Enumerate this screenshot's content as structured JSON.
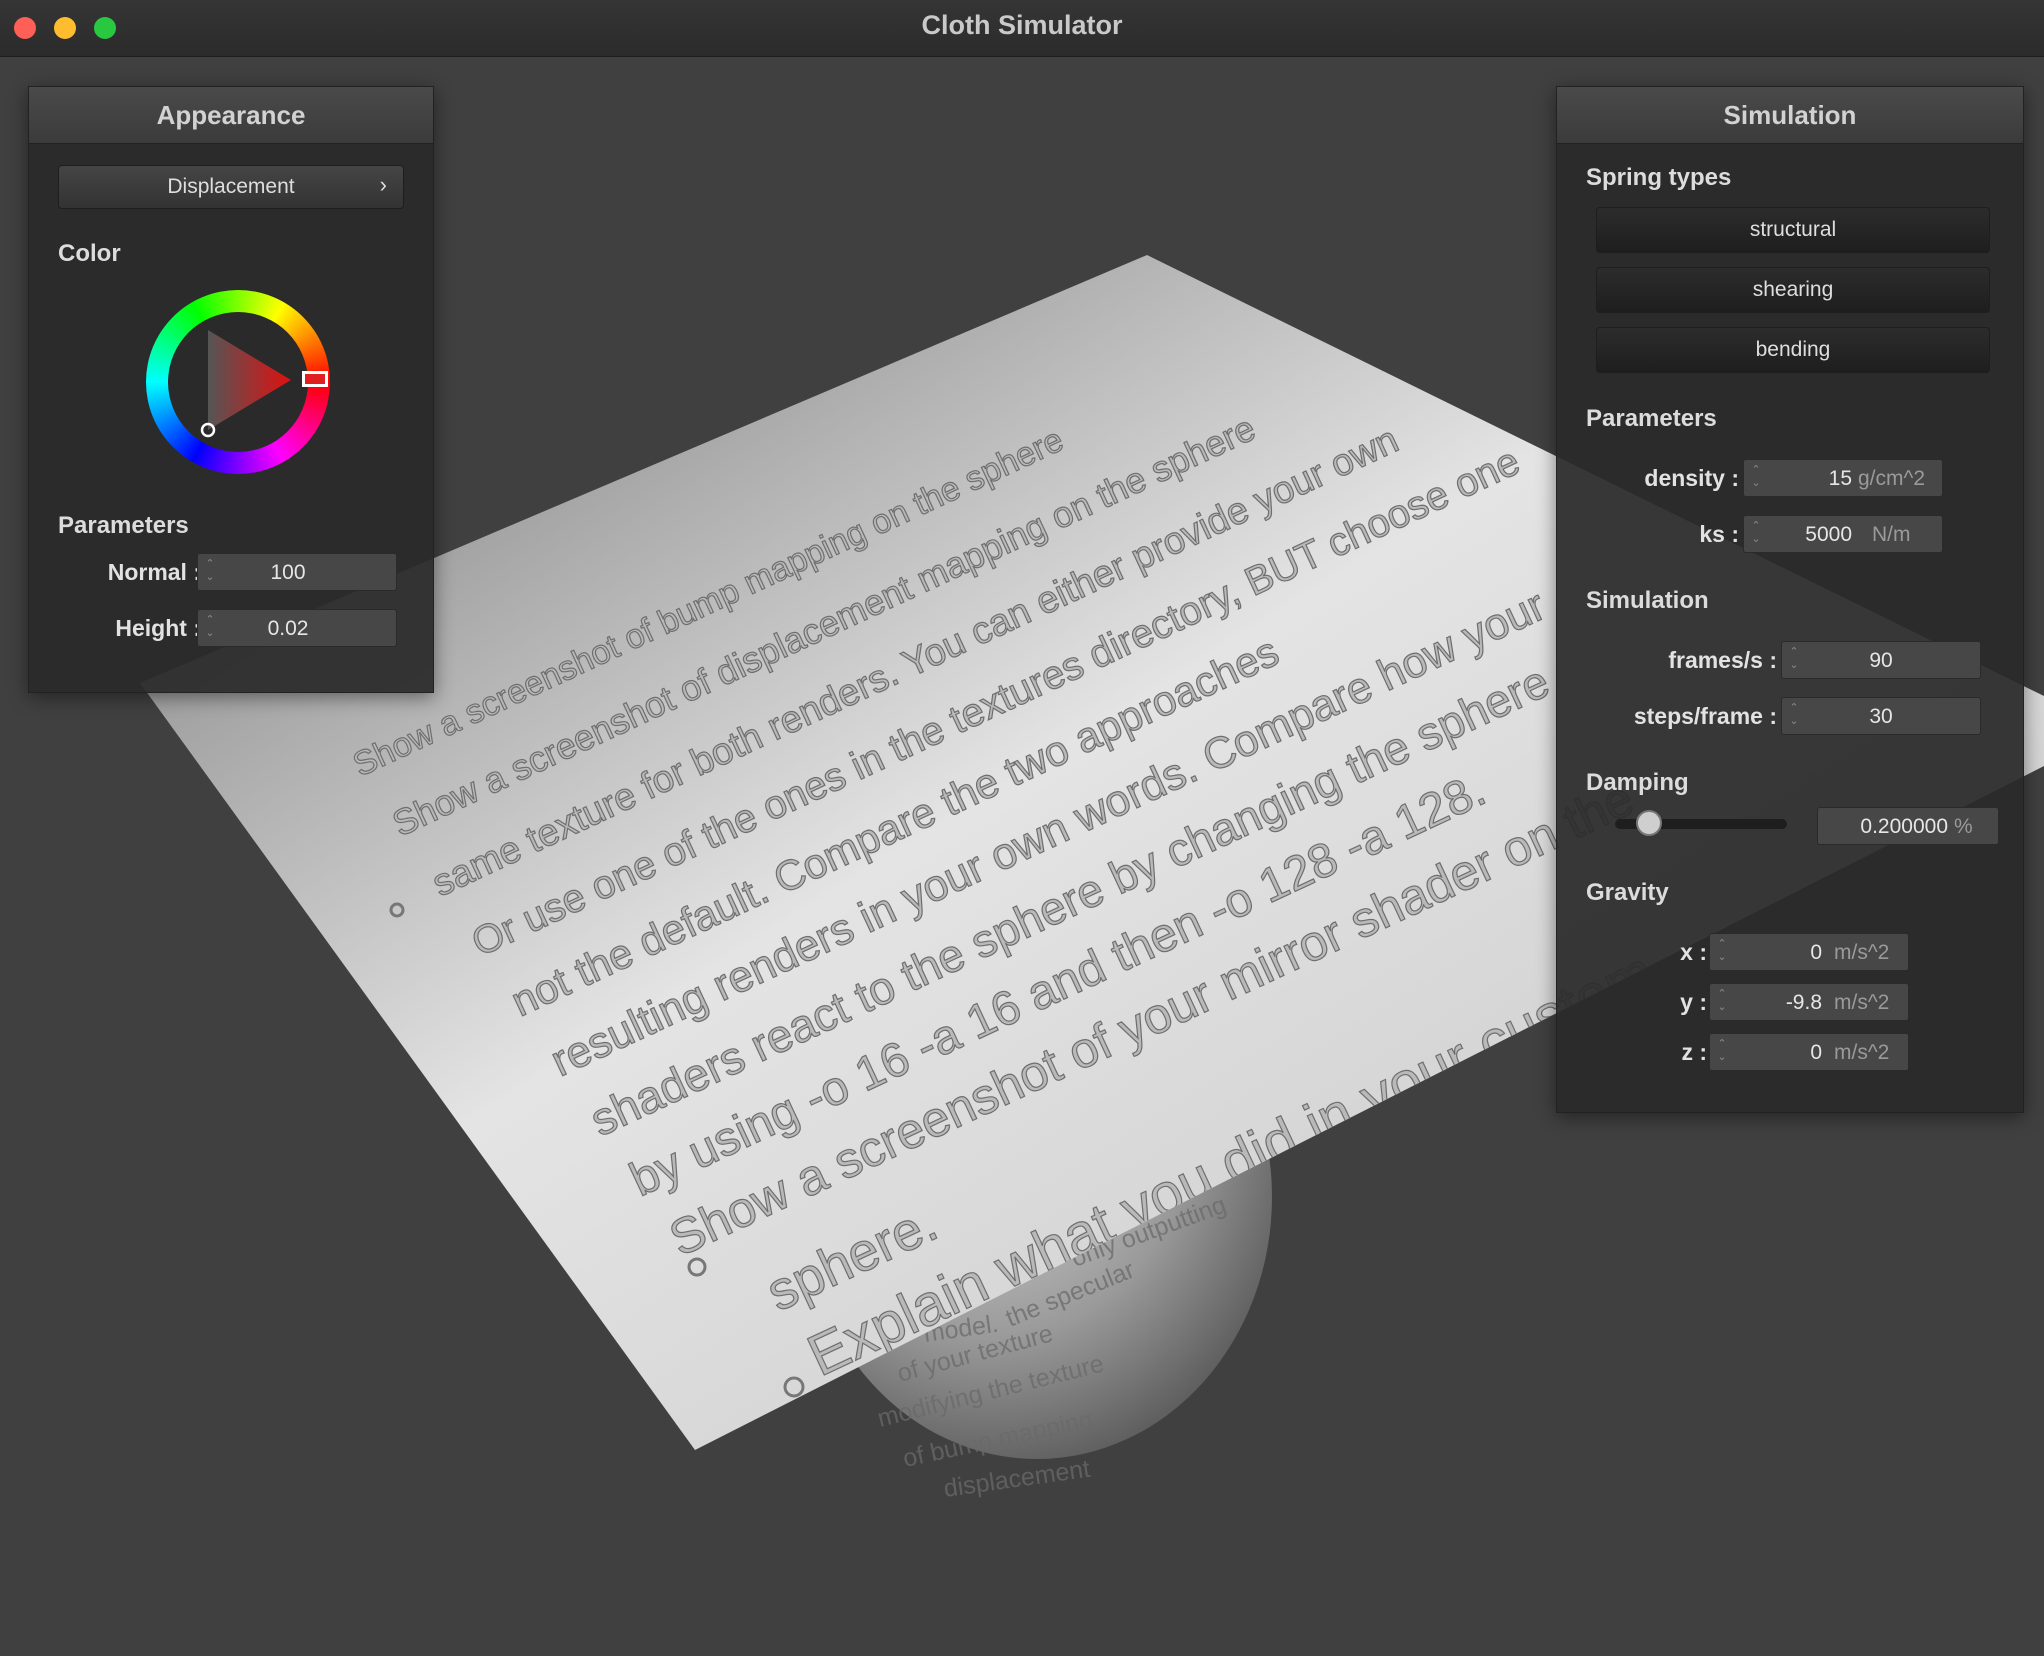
{
  "window": {
    "title": "Cloth Simulator"
  },
  "appearance": {
    "title": "Appearance",
    "shader_button": "Displacement",
    "shader_chevron": "›",
    "color_label": "Color",
    "parameters_label": "Parameters",
    "normal": {
      "label": "Normal :",
      "value": "100"
    },
    "height": {
      "label": "Height :",
      "value": "0.02"
    },
    "selected_hue_color": "#e02020"
  },
  "simulation": {
    "title": "Simulation",
    "spring_types_label": "Spring types",
    "spring_types": [
      "structural",
      "shearing",
      "bending"
    ],
    "parameters_label": "Parameters",
    "density": {
      "label": "density :",
      "value": "15",
      "unit": "g/cm^2"
    },
    "ks": {
      "label": "ks :",
      "value": "5000",
      "unit": "N/m"
    },
    "sim_label": "Simulation",
    "frames": {
      "label": "frames/s :",
      "value": "90"
    },
    "steps": {
      "label": "steps/frame :",
      "value": "30"
    },
    "damping_label": "Damping",
    "damping": {
      "value": "0.200000",
      "unit": "%",
      "fraction": 0.2
    },
    "gravity_label": "Gravity",
    "gravity": {
      "x": {
        "label": "x :",
        "value": "0",
        "unit": "m/s^2"
      },
      "y": {
        "label": "y :",
        "value": "-9.8",
        "unit": "m/s^2"
      },
      "z": {
        "label": "z :",
        "value": "0",
        "unit": "m/s^2"
      }
    }
  },
  "cloth_text": {
    "lines": [
      "Show a screenshot of bump mapping on the sphere",
      "Show a screenshot of displacement mapping on the sphere",
      "same texture for both renders. You can either provide your own",
      "Or use one of the ones in the textures directory, BUT choose one",
      "not the default. Compare the two approaches",
      "resulting renders in your own words. Compare how your",
      "shaders react to the sphere by changing the sphere",
      "by using -o 16 -a 16 and then -o 128 -a 128.",
      "Show a screenshot of your mirror shader on the"
    ],
    "sphere_line": "sphere.",
    "explain_line": "Explain what you did in your custom"
  },
  "sphere_text": [
    "only outputting",
    "the specular",
    "model.",
    "of your texture",
    "modifying the texture",
    "of bump mapping",
    "displacement"
  ]
}
